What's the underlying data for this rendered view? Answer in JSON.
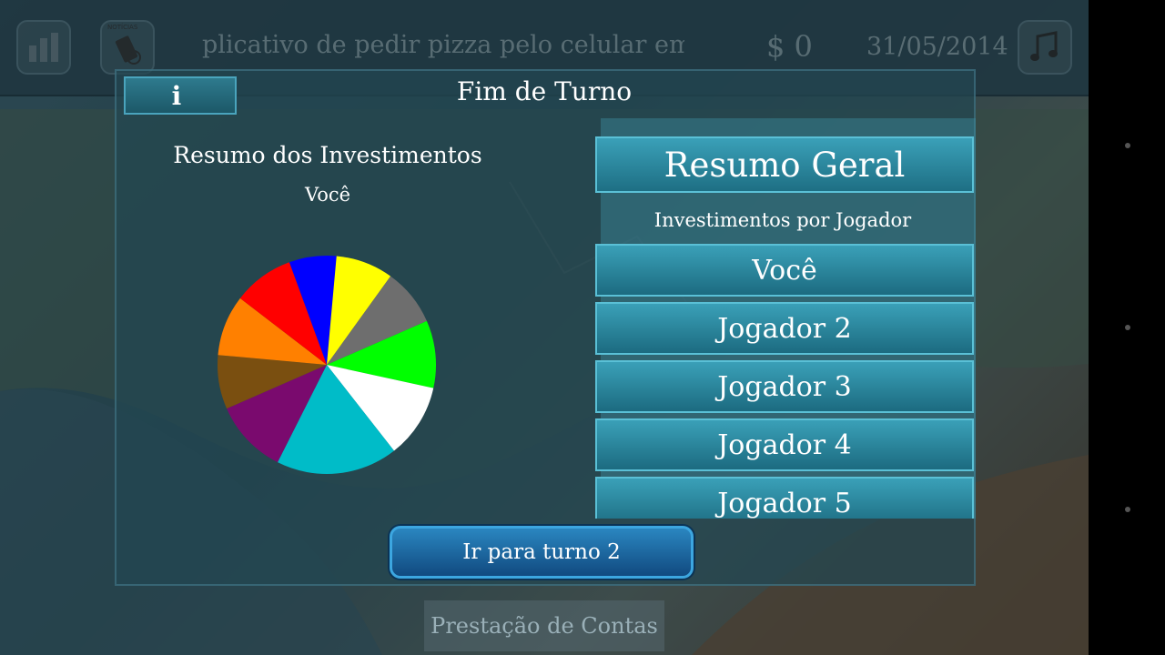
{
  "topbar": {
    "news_icon_label": "NOTÍCIAS",
    "ticker": "plicativo de pedir pizza pelo celular em q",
    "money": "$ 0",
    "date": "31/05/2014"
  },
  "modal": {
    "info_label": "i",
    "title": "Fim de Turno",
    "left_title": "Resumo dos Investimentos",
    "left_subtitle": "Você",
    "right_header": "Resumo Geral",
    "right_subtitle": "Investimentos por Jogador",
    "players": [
      "Você",
      "Jogador 2",
      "Jogador 3",
      "Jogador 4",
      "Jogador 5"
    ],
    "go_button": "Ir para turno 2"
  },
  "bottom": {
    "prestacao_label": "Prestação de Contas"
  },
  "colors": {
    "modal_bg": "#234652",
    "panel_button": "#2a8ca4",
    "go_button": "#1f6aa8"
  },
  "chart_data": {
    "type": "pie",
    "title": "",
    "slices": [
      {
        "color": "#0000ff",
        "value": 0.07
      },
      {
        "color": "#ffff00",
        "value": 0.085
      },
      {
        "color": "#6e6e6e",
        "value": 0.085
      },
      {
        "color": "#00ff00",
        "value": 0.1
      },
      {
        "color": "#ffffff",
        "value": 0.11
      },
      {
        "color": "#00bcc8",
        "value": 0.18
      },
      {
        "color": "#7a0a6e",
        "value": 0.11
      },
      {
        "color": "#7a4f10",
        "value": 0.08
      },
      {
        "color": "#ff8000",
        "value": 0.09
      },
      {
        "color": "#ff0000",
        "value": 0.09
      }
    ]
  }
}
